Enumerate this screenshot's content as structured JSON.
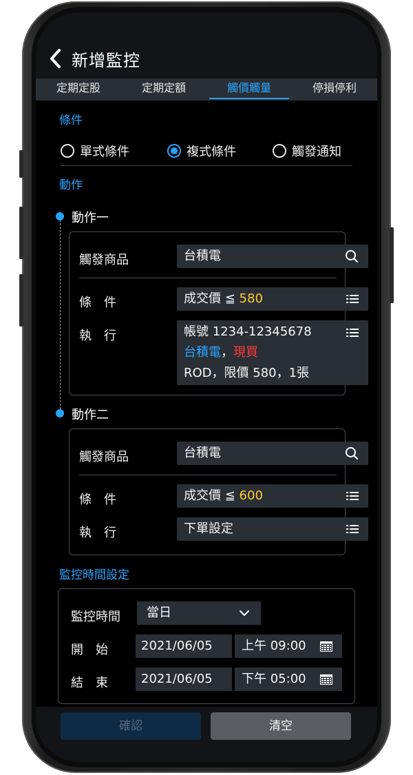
{
  "header": {
    "title": "新增監控"
  },
  "tabs": [
    {
      "label": "定期定股"
    },
    {
      "label": "定期定額"
    },
    {
      "label": "觸價觸量",
      "active": true
    },
    {
      "label": "停損停利"
    }
  ],
  "condition_section": {
    "title": "條件",
    "options": [
      {
        "label": "單式條件",
        "selected": false
      },
      {
        "label": "複式條件",
        "selected": true
      },
      {
        "label": "觸發通知",
        "selected": false
      }
    ]
  },
  "action_section": {
    "title": "動作",
    "action1": {
      "title": "動作一",
      "product_label": "觸發商品",
      "product_value": "台積電",
      "condition_label": "條　件",
      "condition_prefix": "成交價 ≦",
      "condition_price": "580",
      "execute_label": "執　行",
      "execute_line1": "帳號 1234-12345678",
      "execute_stock": "台積電",
      "execute_sep": "，",
      "execute_type": "現買",
      "execute_line3": "ROD，限價 580，1張"
    },
    "action2": {
      "title": "動作二",
      "product_label": "觸發商品",
      "product_value": "台積電",
      "condition_label": "條　件",
      "condition_prefix": "成交價 ≦",
      "condition_price": "600",
      "execute_label": "執　行",
      "execute_value": "下單設定"
    }
  },
  "time_section": {
    "title": "監控時間設定",
    "period_label": "監控時間",
    "period_value": "當日",
    "start_label": "開　始",
    "start_date": "2021/06/05",
    "start_time": "上午 09:00",
    "end_label": "結　束",
    "end_date": "2021/06/05",
    "end_time": "下午 05:00"
  },
  "footer": {
    "confirm_label": "確認",
    "clear_label": "清空"
  },
  "colors": {
    "accent": "#29a3ff",
    "price_highlight": "#ffcc33",
    "buy": "#ff3b3b"
  },
  "icons": [
    "back-icon",
    "search-icon",
    "list-icon",
    "chevron-down-icon",
    "calendar-icon"
  ]
}
